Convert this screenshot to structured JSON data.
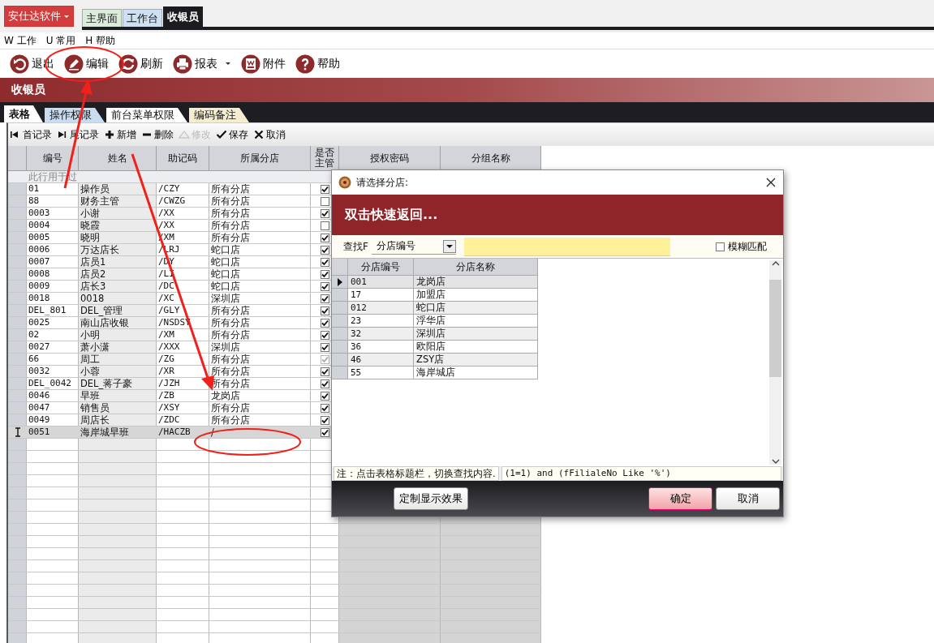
{
  "app_button": {
    "label": "安仕达软件"
  },
  "window_tabs": [
    {
      "label": "主界面",
      "selected": false,
      "color": "#dcebdc"
    },
    {
      "label": "工作台",
      "selected": false,
      "color": "#cfe0f3"
    },
    {
      "label": "收银员",
      "selected": true,
      "color": "#1c1c20"
    }
  ],
  "menu": [
    "W 工作",
    "U 常用",
    "H 帮助"
  ],
  "toolbar": [
    {
      "kind": "exit",
      "label": "退出"
    },
    {
      "kind": "edit",
      "label": "编辑"
    },
    {
      "kind": "refresh",
      "label": "刷新"
    },
    {
      "kind": "print",
      "label": "报表",
      "dropdown": true
    },
    {
      "kind": "attach",
      "label": "附件"
    },
    {
      "kind": "help",
      "label": "帮助"
    }
  ],
  "page_title": "收银员",
  "page_tabs": [
    {
      "label": "表格",
      "selected": true,
      "color": "#ffffff"
    },
    {
      "label": "操作权限",
      "selected": false,
      "color": "#c9dcf0"
    },
    {
      "label": "前台菜单权限",
      "selected": false,
      "color": "#ffffff"
    },
    {
      "label": "编码备注",
      "selected": false,
      "color": "#f5ecd2"
    }
  ],
  "nav": [
    {
      "kind": "first",
      "label": "首记录",
      "disabled": false
    },
    {
      "kind": "last",
      "label": "尾记录",
      "disabled": false
    },
    {
      "kind": "add",
      "label": "新增",
      "disabled": false
    },
    {
      "kind": "delete",
      "label": "删除",
      "disabled": false
    },
    {
      "kind": "modify",
      "label": "修改",
      "disabled": true
    },
    {
      "kind": "save",
      "label": "保存",
      "disabled": false
    },
    {
      "kind": "cancel",
      "label": "取消",
      "disabled": false
    }
  ],
  "table": {
    "columns": [
      "编号",
      "姓名",
      "助记码",
      "所属分店",
      "是否主管",
      "授权密码",
      "分组名称"
    ],
    "filter_hint": "此行用于过",
    "rows": [
      {
        "code": "01",
        "name": "操作员",
        "mnemonic": "/CZY",
        "store": "所有分店",
        "checked": true,
        "disabled": false,
        "selected": false
      },
      {
        "code": "88",
        "name": "财务主管",
        "mnemonic": "/CWZG",
        "store": "所有分店",
        "checked": false,
        "disabled": false,
        "selected": false
      },
      {
        "code": "0003",
        "name": "小谢",
        "mnemonic": "/XX",
        "store": "所有分店",
        "checked": true,
        "disabled": false,
        "selected": false
      },
      {
        "code": "0004",
        "name": "晓霞",
        "mnemonic": "/XX",
        "store": "所有分店",
        "checked": false,
        "disabled": false,
        "selected": false
      },
      {
        "code": "0005",
        "name": "晓明",
        "mnemonic": "/XM",
        "store": "所有分店",
        "checked": true,
        "disabled": false,
        "selected": false
      },
      {
        "code": "0006",
        "name": "万达店长",
        "mnemonic": "/LRJ",
        "store": "蛇口店",
        "checked": true,
        "disabled": false,
        "selected": false
      },
      {
        "code": "0007",
        "name": "店员1",
        "mnemonic": "/DY",
        "store": "蛇口店",
        "checked": true,
        "disabled": false,
        "selected": false
      },
      {
        "code": "0008",
        "name": "店员2",
        "mnemonic": "/LI",
        "store": "蛇口店",
        "checked": true,
        "disabled": false,
        "selected": false
      },
      {
        "code": "0009",
        "name": "店长3",
        "mnemonic": "/DC",
        "store": "蛇口店",
        "checked": true,
        "disabled": false,
        "selected": false
      },
      {
        "code": "0018",
        "name": "0018",
        "mnemonic": "/XC",
        "store": "深圳店",
        "checked": true,
        "disabled": false,
        "selected": false
      },
      {
        "code": "DEL_801",
        "name": "DEL_管理",
        "mnemonic": "/GLY",
        "store": "所有分店",
        "checked": true,
        "disabled": false,
        "selected": false
      },
      {
        "code": "0025",
        "name": "南山店收银",
        "mnemonic": "/NSDSY",
        "store": "所有分店",
        "checked": true,
        "disabled": false,
        "selected": false
      },
      {
        "code": "02",
        "name": "小明",
        "mnemonic": "/XM",
        "store": "所有分店",
        "checked": true,
        "disabled": false,
        "selected": false
      },
      {
        "code": "0027",
        "name": "萧小潇",
        "mnemonic": "/XXX",
        "store": "深圳店",
        "checked": true,
        "disabled": false,
        "selected": false
      },
      {
        "code": "66",
        "name": "周工",
        "mnemonic": "/ZG",
        "store": "所有分店",
        "checked": true,
        "disabled": true,
        "selected": false
      },
      {
        "code": "0032",
        "name": "小蓉",
        "mnemonic": "/XR",
        "store": "所有分店",
        "checked": true,
        "disabled": false,
        "selected": false
      },
      {
        "code": "DEL_0042",
        "name": "DEL_蒋子豪",
        "mnemonic": "/JZH",
        "store": "所有分店",
        "checked": true,
        "disabled": false,
        "selected": false
      },
      {
        "code": "0046",
        "name": "早班",
        "mnemonic": "/ZB",
        "store": "龙岗店",
        "checked": true,
        "disabled": false,
        "selected": false
      },
      {
        "code": "0047",
        "name": "销售员",
        "mnemonic": "/XSY",
        "store": "所有分店",
        "checked": true,
        "disabled": false,
        "selected": false
      },
      {
        "code": "0049",
        "name": "周店长",
        "mnemonic": "/ZDC",
        "store": "所有分店",
        "checked": true,
        "disabled": false,
        "selected": false
      },
      {
        "code": "0051",
        "name": "海岸城早班",
        "mnemonic": "/HACZB",
        "store": "/",
        "checked": true,
        "disabled": false,
        "selected": true
      }
    ]
  },
  "dialog": {
    "title": "请选择分店:",
    "banner": "双击快速返回...",
    "search_label": "查找F",
    "search_field": "分店编号",
    "fuzzy": {
      "label": "模糊匹配",
      "checked": false
    },
    "columns": [
      "分店编号",
      "分店名称"
    ],
    "rows": [
      {
        "code": "001",
        "name": "龙岗店",
        "selected": true
      },
      {
        "code": "17",
        "name": "加盟店",
        "selected": false
      },
      {
        "code": "012",
        "name": "蛇口店",
        "selected": false
      },
      {
        "code": "23",
        "name": "浮华店",
        "selected": false
      },
      {
        "code": "32",
        "name": "深圳店",
        "selected": false
      },
      {
        "code": "36",
        "name": "欧阳店",
        "selected": false
      },
      {
        "code": "46",
        "name": "ZSY店",
        "selected": false
      },
      {
        "code": "55",
        "name": "海岸城店",
        "selected": false
      }
    ],
    "note": "注：点击表格标题栏，切换查找内容.",
    "filter": "(1=1) and (fFilialeNo Like '%')",
    "buttons": [
      {
        "kind": "custom",
        "label": "定制显示效果"
      },
      {
        "kind": "ok",
        "label": "确定"
      },
      {
        "kind": "cancel",
        "label": "取消"
      }
    ]
  }
}
